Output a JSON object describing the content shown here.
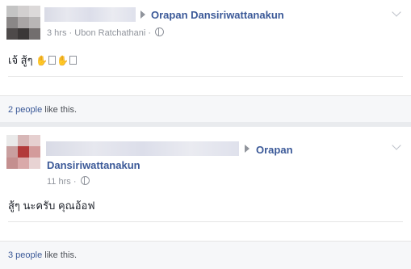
{
  "posts": [
    {
      "author": "Orapan Dansiriwattanakun",
      "time": "3 hrs",
      "location": "Ubon Ratchathani",
      "separator": "·",
      "text": "เจ้ สู้ๆ",
      "likes_count": "2 people",
      "likes_suffix": " like this."
    },
    {
      "author_line1": "Orapan",
      "author_line2": "Dansiriwattanakun",
      "time": "11 hrs",
      "separator": "·",
      "text": "สู้ๆ นะครับ คุณอ้อฟ",
      "likes_count": "3 people",
      "likes_suffix": " like this."
    }
  ],
  "colors": {
    "link": "#3b5998",
    "meta": "#90949c",
    "background": "#e9ebee"
  },
  "icons": [
    "arrow-right-icon",
    "globe-icon",
    "chevron-down-icon",
    "hand-emoji-icon"
  ]
}
